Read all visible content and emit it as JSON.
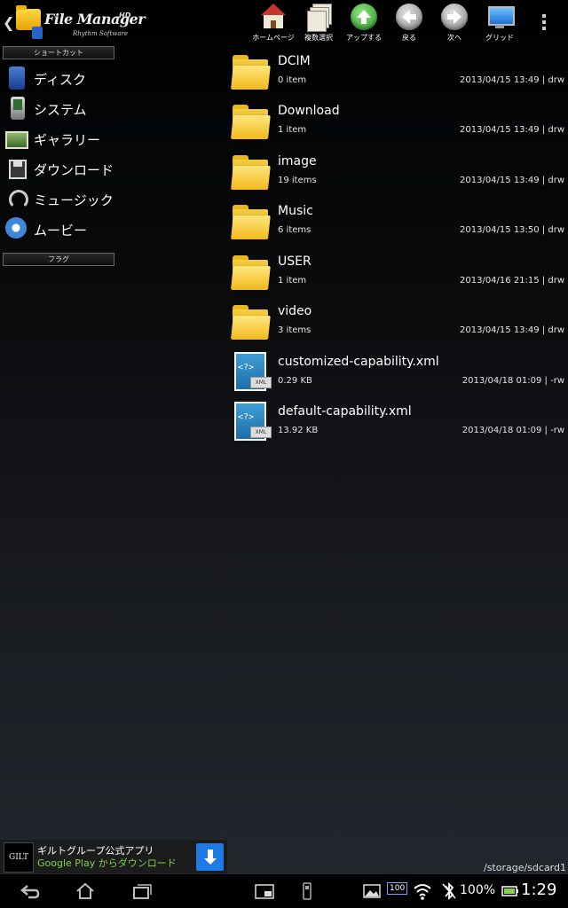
{
  "app": {
    "title": "File Manager",
    "title_badge": "HD",
    "vendor": "Rhythm Software"
  },
  "toolbar": [
    {
      "label": "ホームページ",
      "icon": "home-icon"
    },
    {
      "label": "複数選択",
      "icon": "multi-select-icon"
    },
    {
      "label": "アップする",
      "icon": "up-arrow-icon"
    },
    {
      "label": "戻る",
      "icon": "back-arrow-icon"
    },
    {
      "label": "次へ",
      "icon": "forward-arrow-icon"
    },
    {
      "label": "グリッド",
      "icon": "grid-monitor-icon"
    }
  ],
  "sidebar": {
    "shortcut_header": "ショートカット",
    "items": [
      {
        "label": "ディスク",
        "icon": "disk-icon"
      },
      {
        "label": "システム",
        "icon": "system-icon"
      },
      {
        "label": "ギャラリー",
        "icon": "gallery-icon"
      },
      {
        "label": "ダウンロード",
        "icon": "download-icon"
      },
      {
        "label": "ミュージック",
        "icon": "music-icon"
      },
      {
        "label": "ムービー",
        "icon": "movie-icon"
      }
    ],
    "flag_header": "フラグ"
  },
  "files": [
    {
      "name": "DCIM",
      "count": "0 item",
      "meta": "2013/04/15 13:49 | drw",
      "type": "folder"
    },
    {
      "name": "Download",
      "count": "1 item",
      "meta": "2013/04/15 13:49 | drw",
      "type": "folder"
    },
    {
      "name": "image",
      "count": "19 items",
      "meta": "2013/04/15 13:49 | drw",
      "type": "folder"
    },
    {
      "name": "Music",
      "count": "6 items",
      "meta": "2013/04/15 13:50 | drw",
      "type": "folder"
    },
    {
      "name": "USER",
      "count": "1 item",
      "meta": "2013/04/16 21:15 | drw",
      "type": "folder"
    },
    {
      "name": "video",
      "count": "3 items",
      "meta": "2013/04/15 13:49 | drw",
      "type": "folder"
    },
    {
      "name": "customized-capability.xml",
      "count": "0.29 KB",
      "meta": "2013/04/18 01:09 | -rw",
      "type": "xml"
    },
    {
      "name": "default-capability.xml",
      "count": "13.92 KB",
      "meta": "2013/04/18 01:09 | -rw",
      "type": "xml"
    }
  ],
  "xml_icon": {
    "code": "<?>",
    "tag": "XML"
  },
  "ad": {
    "logo": "GILT",
    "title": "ギルトグループ公式アプリ",
    "subtitle": "Google Play からダウンロード"
  },
  "path": "/storage/sdcard1",
  "status": {
    "battery": "100%",
    "time": "1:29",
    "signal_badge": "100"
  },
  "colors": {
    "accent_green": "#7fd34e",
    "ad_button": "#1e7ae6"
  }
}
